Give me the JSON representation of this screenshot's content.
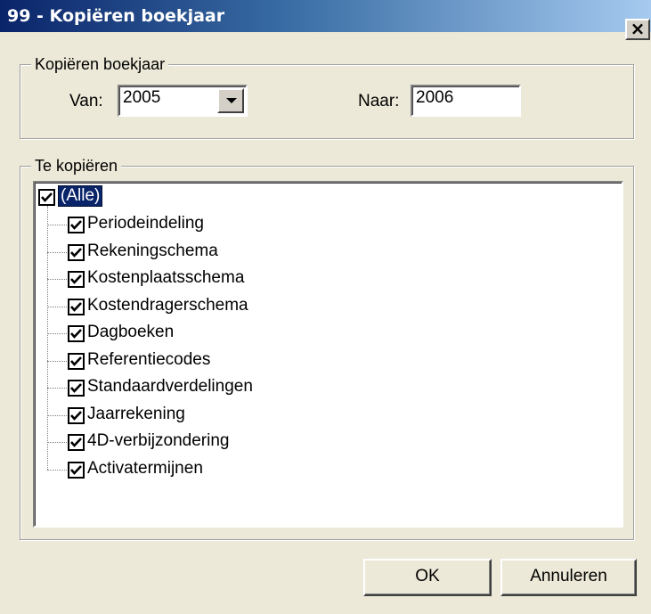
{
  "window": {
    "title": "99 - Kopiëren boekjaar",
    "close_label": "×"
  },
  "copy_group": {
    "legend": "Kopiëren boekjaar",
    "from_label": "Van:",
    "from_value": "2005",
    "to_label": "Naar:",
    "to_value": "2006"
  },
  "items_group": {
    "legend": "Te kopiëren",
    "root": {
      "label": "(Alle)",
      "checked": true
    },
    "items": [
      {
        "label": "Periodeindeling",
        "checked": true
      },
      {
        "label": "Rekeningschema",
        "checked": true
      },
      {
        "label": "Kostenplaatsschema",
        "checked": true
      },
      {
        "label": "Kostendragerschema",
        "checked": true
      },
      {
        "label": "Dagboeken",
        "checked": true
      },
      {
        "label": "Referentiecodes",
        "checked": true
      },
      {
        "label": "Standaardverdelingen",
        "checked": true
      },
      {
        "label": "Jaarrekening",
        "checked": true
      },
      {
        "label": "4D-verbijzondering",
        "checked": true
      },
      {
        "label": "Activatermijnen",
        "checked": true
      }
    ]
  },
  "buttons": {
    "ok": "OK",
    "cancel": "Annuleren"
  }
}
